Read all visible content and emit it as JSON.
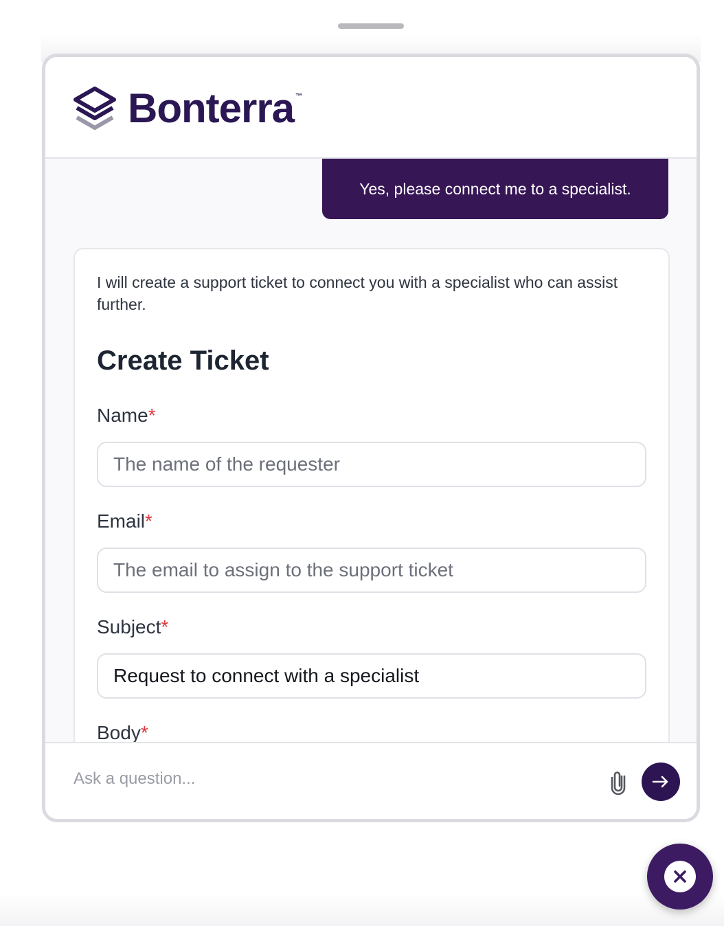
{
  "brand": {
    "name": "Bonterra",
    "trademark": "™",
    "primary_color": "#371656",
    "required_color": "#e0393e"
  },
  "conversation": {
    "user_message": "Yes, please connect me to a specialist.",
    "bot_intro": "I will create a support ticket to connect you with a specialist who can assist further."
  },
  "ticket_form": {
    "title": "Create Ticket",
    "required_marker": "*",
    "fields": [
      {
        "label": "Name",
        "placeholder": "The name of the requester",
        "value": ""
      },
      {
        "label": "Email",
        "placeholder": "The email to assign to the support ticket",
        "value": ""
      },
      {
        "label": "Subject",
        "placeholder": "",
        "value": "Request to connect with a specialist"
      },
      {
        "label": "Body"
      }
    ]
  },
  "composer": {
    "placeholder": "Ask a question...",
    "attach_icon": "paperclip-icon",
    "send_icon": "arrow-right-icon"
  },
  "close_button": {
    "icon": "close-icon"
  }
}
